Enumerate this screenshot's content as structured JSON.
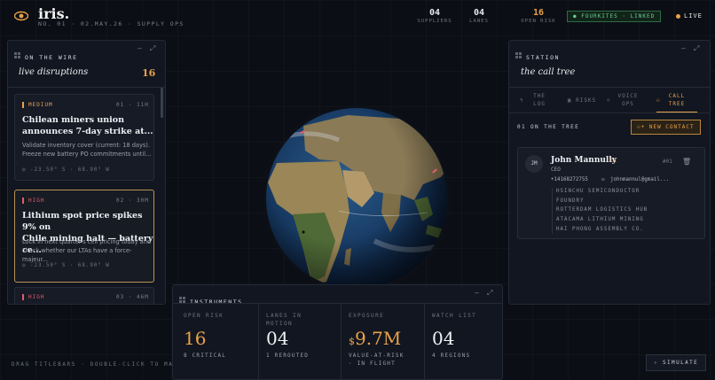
{
  "brand": {
    "name": "iris.",
    "subtitle": "NO. 01 · 02.MAY.26 · SUPPLY OPS"
  },
  "stats": [
    {
      "value": "04",
      "label": "SUPPLIERS"
    },
    {
      "value": "04",
      "label": "LANES"
    },
    {
      "value": "16",
      "label": "OPEN RISK"
    }
  ],
  "status": {
    "linked": "● FOURKITES · LINKED",
    "live": "LIVE"
  },
  "wire": {
    "title": "ON THE WIRE",
    "heading": "live disruptions",
    "count": "16",
    "cards": [
      {
        "severity": "MEDIUM",
        "meta": "01 · 11H",
        "title_1": "Chilean miners union",
        "title_2": "announces 7-day strike at...",
        "body_1": "Validate inventory cover (current: 18 days).",
        "body_2": "Freeze new battery PO commitments until...",
        "coord": "◎ -23.50° S · 68.90° W"
      },
      {
        "severity": "HIGH",
        "meta": "02 · 30M",
        "title_1": "Lithium spot price spikes 9% on",
        "title_2": "Chile mining halt — battery ce...",
        "body_1": "Lock in next quarter's cell pricing today and",
        "body_2": "check whether our LTAs have a force-majeur...",
        "coord": "◎ -23.50° S · 68.90° W"
      },
      {
        "severity": "HIGH",
        "meta": "03 · 46M"
      }
    ]
  },
  "station": {
    "title": "STATION",
    "heading": "the call tree",
    "tabs": [
      {
        "line1": "THE",
        "line2": "LOG"
      },
      {
        "line1": "RISKS",
        "line2": ""
      },
      {
        "line1": "VOICE",
        "line2": "OPS"
      },
      {
        "line1": "CALL",
        "line2": "TREE"
      }
    ],
    "tree_label": "01 ON THE TREE",
    "new_contact": "NEW CONTACT",
    "contact": {
      "initials": "JM",
      "name": "John Mannully",
      "level": "L1",
      "role": "CEO",
      "index": "#01",
      "phone": "+14168272755",
      "email": "johnmannul@gmail...",
      "orgs": [
        "HSINCHU SEMICONDUCTOR",
        "FOUNDRY",
        "ROTTERDAM LOGISTICS HUB",
        "ATACAMA LITHIUM MINING",
        "HAI PHONG ASSEMBLY CO."
      ]
    }
  },
  "instruments": {
    "title": "INSTRUMENTS",
    "cells": [
      {
        "l1": "OPEN RISK",
        "l2": "",
        "value": "16",
        "s1": "8 CRITICAL",
        "s2": ""
      },
      {
        "l1": "LANES IN",
        "l2": "MOTION",
        "value": "04",
        "s1": "1 REROUTED",
        "s2": ""
      },
      {
        "l1": "EXPOSURE",
        "l2": "",
        "prefix": "$",
        "value": "9.7M",
        "s1": "VALUE-AT-RISK",
        "s2": "· IN FLIGHT"
      },
      {
        "l1": "WATCH LIST",
        "l2": "",
        "value": "04",
        "s1": "4 REGIONS",
        "s2": ""
      }
    ]
  },
  "footer": "DRAG TITLEBARS · DOUBLE-CLICK TO MA",
  "simulate": "SIMULATE",
  "colors": {
    "accent": "#e8a24a",
    "high": "#e25c6a",
    "linked": "#6fd08f"
  }
}
